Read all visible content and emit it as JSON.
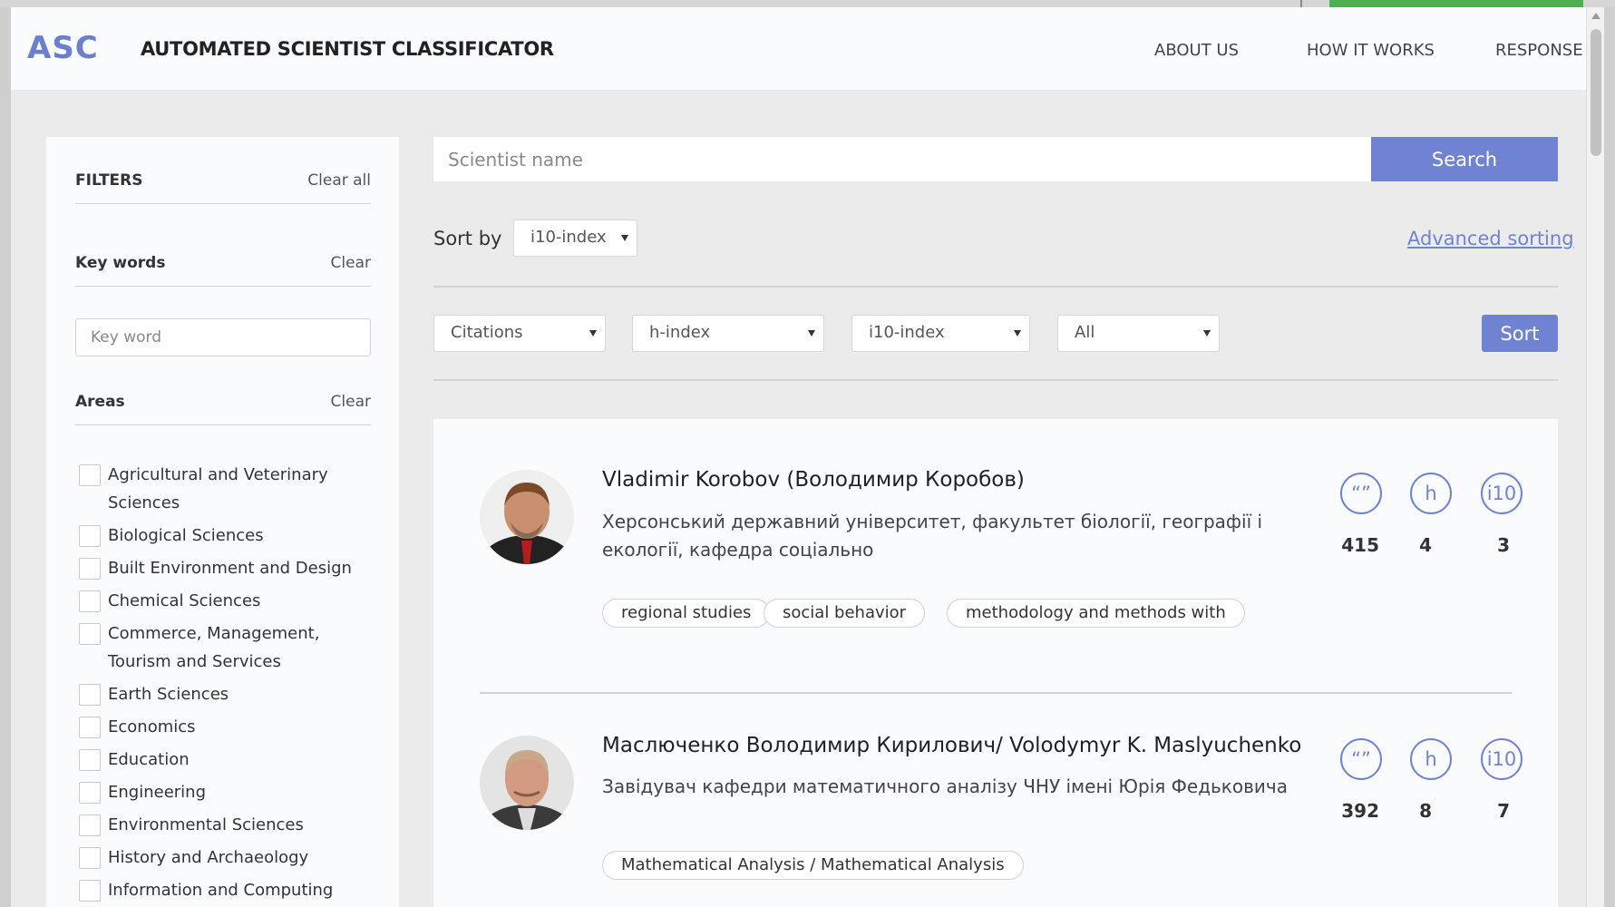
{
  "header": {
    "logo": "ASC",
    "title": "AUTOMATED SCIENTIST CLASSIFICATOR",
    "nav": [
      "ABOUT US",
      "HOW IT WORKS",
      "RESPONSE"
    ]
  },
  "filters": {
    "title": "FILTERS",
    "clear_all": "Clear all",
    "keywords": {
      "title": "Key words",
      "clear": "Clear",
      "placeholder": "Key word"
    },
    "areas": {
      "title": "Areas",
      "clear": "Clear",
      "items": [
        "Agricultural and Veterinary Sciences",
        "Biological Sciences",
        "Built Environment and Design",
        "Chemical Sciences",
        "Commerce, Management, Tourism and Services",
        "Earth Sciences",
        "Economics",
        "Education",
        "Engineering",
        "Environmental Sciences",
        "History and Archaeology",
        "Information and Computing"
      ]
    }
  },
  "search": {
    "placeholder": "Scientist name",
    "button": "Search"
  },
  "sort": {
    "label": "Sort by",
    "selected": "i10-index",
    "advanced_link": "Advanced sorting",
    "advanced_selects": [
      "Citations",
      "h-index",
      "i10-index",
      "All"
    ],
    "button": "Sort"
  },
  "metric_icons": {
    "citations": "“”",
    "h_index": "h",
    "i10_index": "i10"
  },
  "scientists": [
    {
      "name": "Vladimir Korobov (Володимир Коробов)",
      "affiliation": "Херсонський державний університет, факультет біології, географії і екології, кафедра соціально",
      "tags": [
        "regional studies",
        "social behavior",
        "methodology and methods with"
      ],
      "citations": "415",
      "h_index": "4",
      "i10_index": "3"
    },
    {
      "name": "Маслюченко Володимир Кирилович/ Volodymyr K. Maslyuchenko",
      "affiliation": "Завідувач кафедри математичного аналізу ЧНУ імені Юрія Федьковича",
      "tags": [
        "Mathematical Analysis / Mathematical Analysis"
      ],
      "citations": "392",
      "h_index": "8",
      "i10_index": "7"
    }
  ],
  "colors": {
    "accent": "#6f83d2",
    "background": "#ebebeb",
    "panel": "#fafbfd"
  }
}
